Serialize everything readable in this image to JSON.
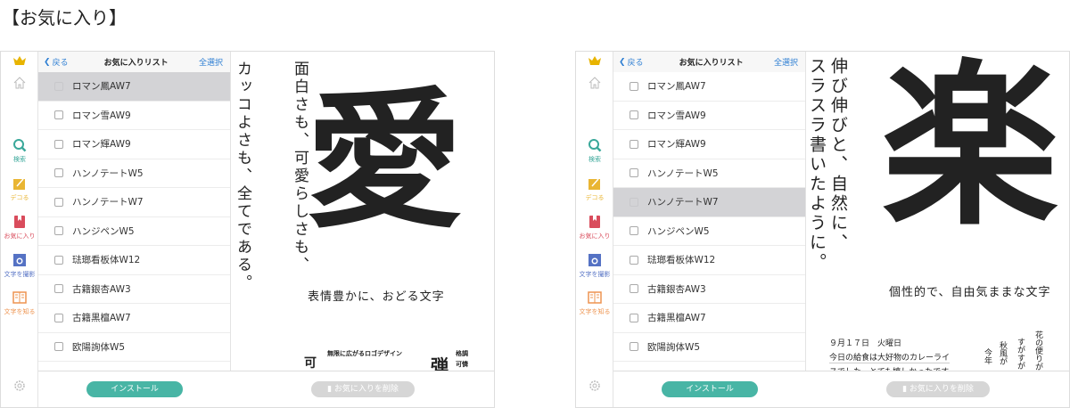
{
  "page_title": "【お気に入り】",
  "sidebar": {
    "items": [
      {
        "label": "",
        "icon": "crown-icon",
        "color": "#e8b400"
      },
      {
        "label": "",
        "icon": "home-icon",
        "color": "#bbbbbb"
      },
      {
        "label": "検索",
        "icon": "search-icon",
        "color": "#3aa89a"
      },
      {
        "label": "デコる",
        "icon": "deco-pencil-icon",
        "color": "#e9b533"
      },
      {
        "label": "お気に入り",
        "icon": "bookmark-icon",
        "color": "#d94c5c"
      },
      {
        "label": "文字を撮影",
        "icon": "camera-icon",
        "color": "#5572c4"
      },
      {
        "label": "文字を知る",
        "icon": "book-icon",
        "color": "#ee9450"
      },
      {
        "label": "",
        "icon": "gear-icon",
        "color": "#bbbbbb"
      }
    ]
  },
  "header": {
    "back": "戻る",
    "title": "お気に入りリスト",
    "select_all": "全選択"
  },
  "fonts": [
    "ロマン鳳AW7",
    "ロマン雪AW9",
    "ロマン輝AW9",
    "ハンノテートW5",
    "ハンノテートW7",
    "ハンジペンW5",
    "琺瑯看板体W12",
    "古籍銀杏AW3",
    "古籍黒檀AW7",
    "欧陽詢体W5"
  ],
  "buttons": {
    "install": "インストール",
    "remove": "お気に入りを削除"
  },
  "screens": [
    {
      "selected": 0,
      "preview": {
        "columns": [
          "面白さも、可愛らしさも、",
          "カッコよさも、全てである。"
        ],
        "glyph": "愛",
        "caption": "表情豊かに、おどる文字",
        "samples": [
          "可",
          "無限に広がるロゴデザイン",
          "弾",
          "格調",
          "可憐"
        ]
      }
    },
    {
      "selected": 4,
      "preview": {
        "columns": [
          "伸び伸びと、自然に、",
          "スラスラ書いたように。"
        ],
        "glyph": "楽",
        "caption": "個性的で、自由気ままな文字",
        "diary": [
          "９月１７日　火曜日",
          "今日の給食は大好物のカレーライ",
          "スでした。とても嬉しかったです"
        ],
        "vertical": [
          "花の便りが",
          "すがすが",
          "秋風が",
          "今年"
        ]
      }
    }
  ]
}
